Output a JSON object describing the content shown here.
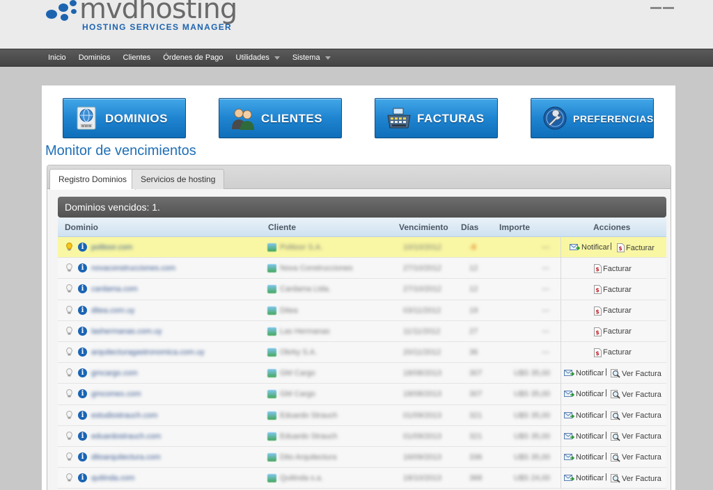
{
  "header": {
    "brand": "mvdhosting",
    "tagline": "HOSTING SERVICES MANAGER"
  },
  "nav": [
    {
      "label": "Inicio",
      "dropdown": false
    },
    {
      "label": "Dominios",
      "dropdown": false
    },
    {
      "label": "Clientes",
      "dropdown": false
    },
    {
      "label": "Órdenes de Pago",
      "dropdown": false
    },
    {
      "label": "Utilidades",
      "dropdown": true
    },
    {
      "label": "Sistema",
      "dropdown": true
    }
  ],
  "shortcuts": [
    {
      "label": "DOMINIOS",
      "icon": "globe-www-icon"
    },
    {
      "label": "CLIENTES",
      "icon": "users-icon"
    },
    {
      "label": "FACTURAS",
      "icon": "cash-register-icon"
    },
    {
      "label": "PREFERENCIAS",
      "icon": "wrench-icon"
    }
  ],
  "page_title": "Monitor de vencimientos",
  "tabs": [
    {
      "label": "Registro Dominios",
      "active": true
    },
    {
      "label": "Servicios de hosting",
      "active": false
    }
  ],
  "grid": {
    "caption": "Dominios vencidos: 1.",
    "columns": {
      "dominio": "Dominio",
      "cliente": "Cliente",
      "vencimiento": "Vencimiento",
      "dias": "Días",
      "importe": "Importe",
      "acciones": "Acciones"
    },
    "action_labels": {
      "notificar": "Notificar",
      "facturar": "Facturar",
      "ver_factura": "Ver Factura",
      "separator": "|"
    },
    "rows": [
      {
        "domain": "politoor.com",
        "client": "Politoor S.A.",
        "date": "10/10/2012",
        "days": "-8",
        "amount": "---",
        "highlight": true,
        "actions": "notificar-facturar"
      },
      {
        "domain": "novaconstrucciones.com",
        "client": "Nova Construcciones",
        "date": "27/10/2012",
        "days": "12",
        "amount": "---",
        "highlight": false,
        "actions": "facturar"
      },
      {
        "domain": "cardama.com",
        "client": "Cardama Ltda.",
        "date": "27/10/2012",
        "days": "12",
        "amount": "---",
        "highlight": false,
        "actions": "facturar"
      },
      {
        "domain": "ditea.com.uy",
        "client": "Ditea",
        "date": "03/11/2012",
        "days": "19",
        "amount": "---",
        "highlight": false,
        "actions": "facturar"
      },
      {
        "domain": "lashermanas.com.uy",
        "client": "Las Hermanas",
        "date": "11/11/2012",
        "days": "27",
        "amount": "---",
        "highlight": false,
        "actions": "facturar"
      },
      {
        "domain": "arquitecturagastronomica.com.uy",
        "client": "Obrky S.A.",
        "date": "20/11/2012",
        "days": "36",
        "amount": "---",
        "highlight": false,
        "actions": "facturar"
      },
      {
        "domain": "gmcargo.com",
        "client": "GM Cargo",
        "date": "18/08/2013",
        "days": "307",
        "amount": "U$S 35,00",
        "highlight": false,
        "actions": "notificar-verfactura"
      },
      {
        "domain": "gmcomex.com",
        "client": "GM Cargo",
        "date": "18/08/2013",
        "days": "307",
        "amount": "U$S 35,00",
        "highlight": false,
        "actions": "notificar-verfactura"
      },
      {
        "domain": "estudiostrauch.com",
        "client": "Eduardo Strauch",
        "date": "01/09/2013",
        "days": "321",
        "amount": "U$S 35,00",
        "highlight": false,
        "actions": "notificar-verfactura"
      },
      {
        "domain": "eduardostrauch.com",
        "client": "Eduardo Strauch",
        "date": "01/09/2013",
        "days": "321",
        "amount": "U$S 35,00",
        "highlight": false,
        "actions": "notificar-verfactura"
      },
      {
        "domain": "ditoarquitectura.com",
        "client": "Dito Arquitectura",
        "date": "16/09/2013",
        "days": "336",
        "amount": "U$S 35,00",
        "highlight": false,
        "actions": "notificar-verfactura"
      },
      {
        "domain": "quitinda.com",
        "client": "Quitinda s.a.",
        "date": "18/10/2013",
        "days": "368",
        "amount": "U$S 24,00",
        "highlight": false,
        "actions": "notificar-verfactura"
      }
    ]
  }
}
